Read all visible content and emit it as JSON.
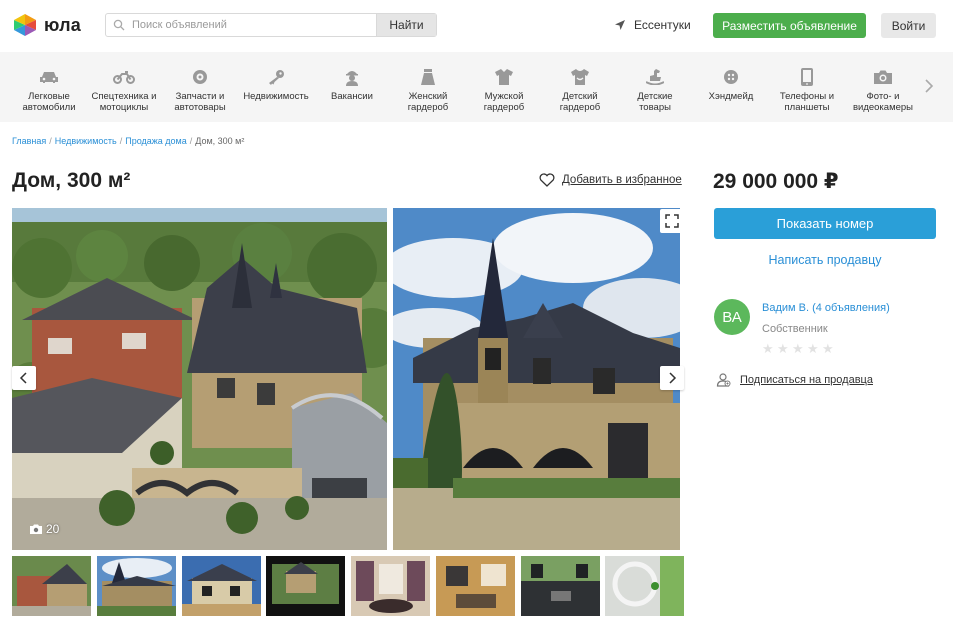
{
  "brand": {
    "logo_text": "юла",
    "colors": {
      "green": "#4cae4c",
      "blue": "#2a9fd8",
      "link": "#2a8fd6"
    }
  },
  "header": {
    "search_placeholder": "Поиск объявлений",
    "search_button": "Найти",
    "location": "Ессентуки",
    "post_button": "Разместить объявление",
    "login_button": "Войти"
  },
  "categories": [
    {
      "line1": "Легковые",
      "line2": "автомобили",
      "icon": "car-icon"
    },
    {
      "line1": "Спецтехника и",
      "line2": "мотоциклы",
      "icon": "motorcycle-icon"
    },
    {
      "line1": "Запчасти и",
      "line2": "автотовары",
      "icon": "wheel-icon"
    },
    {
      "line1": "Недвижимость",
      "line2": "",
      "icon": "key-icon"
    },
    {
      "line1": "Вакансии",
      "line2": "",
      "icon": "worker-icon"
    },
    {
      "line1": "Женский",
      "line2": "гардероб",
      "icon": "skirt-icon"
    },
    {
      "line1": "Мужской",
      "line2": "гардероб",
      "icon": "shirt-icon"
    },
    {
      "line1": "Детский",
      "line2": "гардероб",
      "icon": "kids-clothes-icon"
    },
    {
      "line1": "Детские",
      "line2": "товары",
      "icon": "rocking-horse-icon"
    },
    {
      "line1": "Хэндмейд",
      "line2": "",
      "icon": "button-icon"
    },
    {
      "line1": "Телефоны и",
      "line2": "планшеты",
      "icon": "phone-icon"
    },
    {
      "line1": "Фото- и",
      "line2": "видеокамеры",
      "icon": "camera-icon"
    }
  ],
  "breadcrumb": {
    "items": [
      "Главная",
      "Недвижимость",
      "Продажа дома"
    ],
    "current": "Дом, 300 м²"
  },
  "listing": {
    "title": "Дом, 300 м²",
    "favorite_label": "Добавить в избранное",
    "photo_count": "20",
    "price": "29 000 000 ₽",
    "show_phone": "Показать номер",
    "write_seller": "Написать продавцу"
  },
  "seller": {
    "initials": "ВА",
    "name": "Вадим В. (4 объявления)",
    "type": "Собственник",
    "rating": 0,
    "subscribe": "Подписаться на продавца"
  }
}
